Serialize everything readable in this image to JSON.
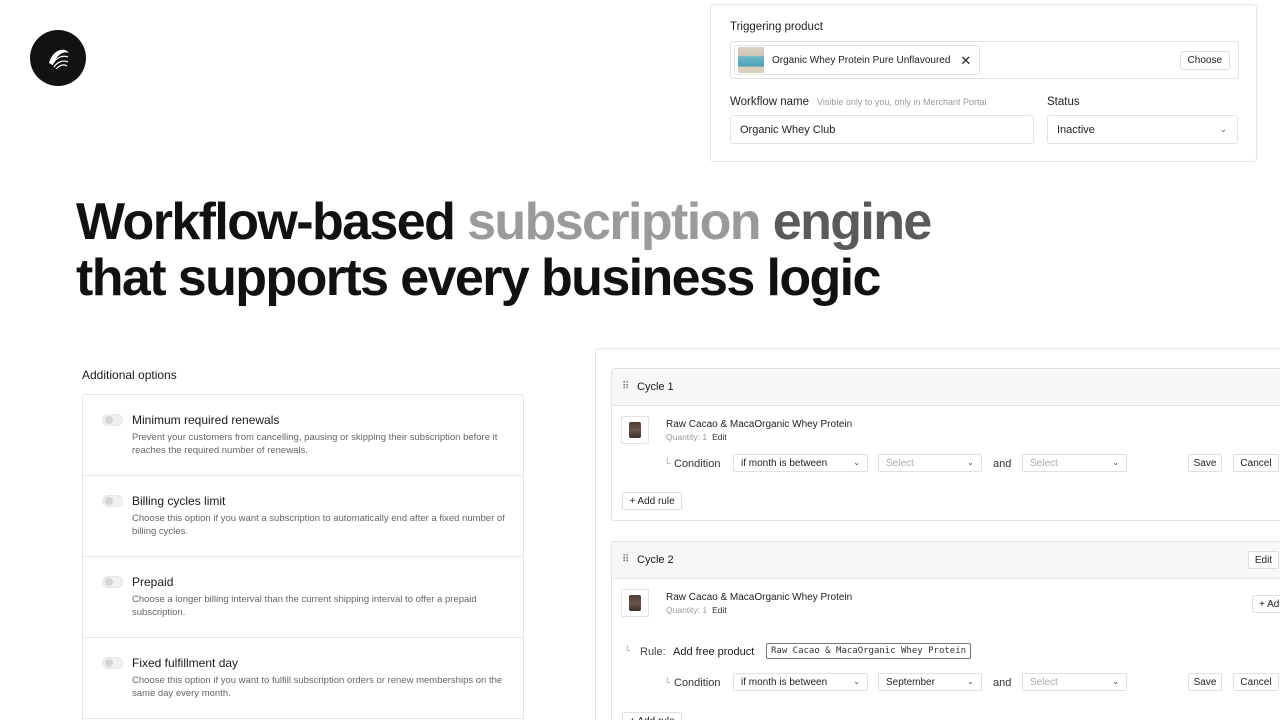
{
  "top_card": {
    "triggering_label": "Triggering product",
    "product_name": "Organic Whey Protein Pure Unflavoured",
    "remove_symbol": "✕",
    "choose_label": "Choose",
    "workflow_name_label": "Workflow name",
    "workflow_name_hint": "Visible only to you, only in Merchant Portal",
    "workflow_name_value": "Organic Whey Club",
    "status_label": "Status",
    "status_value": "Inactive"
  },
  "headline": {
    "part1": "Workflow-based ",
    "part2": "subscription",
    "part3": " engine",
    "line2": "that supports every business logic"
  },
  "additional_options": {
    "title": "Additional options",
    "items": [
      {
        "title": "Minimum required renewals",
        "desc": "Prevent your customers from cancelling, pausing or skipping their subscription before it reaches the required number of renewals."
      },
      {
        "title": "Billing cycles limit",
        "desc": "Choose this option if you want a subscription to automatically end after a fixed number of billing cycles."
      },
      {
        "title": "Prepaid",
        "desc": "Choose a longer billing interval than the current shipping interval to offer a prepaid subscription."
      },
      {
        "title": "Fixed fulfillment day",
        "desc": "Choose this option if you want to fulfill subscription orders or renew memberships on the same day every month."
      }
    ]
  },
  "cycles": {
    "cycle1": {
      "title": "Cycle 1",
      "item_title": "Raw Cacao & MacaOrganic Whey Protein",
      "qty": "Quantity: 1",
      "edit": "Edit",
      "condition_label": "Condition",
      "cond_select": "if month is between",
      "select1": "Select",
      "and": "and",
      "select2": "Select",
      "save": "Save",
      "cancel": "Cancel",
      "add_rule": "+ Add rule"
    },
    "cycle2": {
      "title": "Cycle 2",
      "header_edit": "Edit",
      "item_title": "Raw Cacao & MacaOrganic Whey Protein",
      "qty": "Quantity: 1",
      "edit": "Edit",
      "add_partial": "+ Ad",
      "rule_label": "Rule:",
      "rule_action": "Add free product",
      "rule_product": "Raw Cacao & MacaOrganic Whey Protein",
      "condition_label": "Condition",
      "cond_select": "if month is between",
      "select1": "September",
      "and": "and",
      "select2": "Select",
      "save": "Save",
      "cancel": "Cancel",
      "add_rule": "+ Add rule"
    }
  },
  "colors": {
    "headline": "#111111",
    "headline_fade": "#9a9a9a",
    "border": "#e5e5e5",
    "logo_bg": "#121212"
  }
}
